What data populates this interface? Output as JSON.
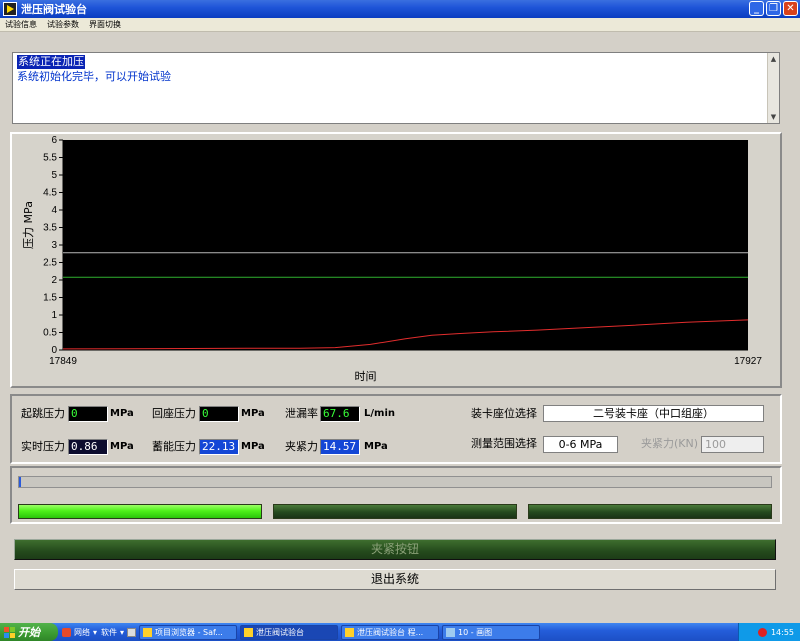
{
  "window": {
    "title": "泄压阀试验台"
  },
  "menu": [
    "试验信息",
    "试验参数",
    "界面切换"
  ],
  "messages": [
    "系统正在加压",
    "系统初始化完毕，可以开始试验"
  ],
  "chart_data": {
    "type": "line",
    "xlabel": "时间",
    "ylabel": "压力 MPa",
    "xlim": [
      17849,
      17927
    ],
    "ylim": [
      0,
      6
    ],
    "yticks": [
      "0",
      "0.5",
      "1",
      "1.5",
      "2",
      "2.5",
      "3",
      "3.5",
      "4",
      "4.5",
      "5",
      "5.5",
      "6"
    ],
    "xticks": [
      "17849",
      "17927"
    ],
    "background": "#000000",
    "series": [
      {
        "color": "#e22d2d",
        "points": [
          [
            17849,
            0.03
          ],
          [
            17860,
            0.04
          ],
          [
            17870,
            0.05
          ],
          [
            17876,
            0.05
          ],
          [
            17880,
            0.07
          ],
          [
            17884,
            0.16
          ],
          [
            17888,
            0.32
          ],
          [
            17891,
            0.42
          ],
          [
            17894,
            0.47
          ],
          [
            17898,
            0.52
          ],
          [
            17903,
            0.57
          ],
          [
            17908,
            0.63
          ],
          [
            17914,
            0.71
          ],
          [
            17920,
            0.79
          ],
          [
            17927,
            0.86
          ]
        ]
      },
      {
        "color": "#b8b8b8",
        "points": [
          [
            17849,
            2.78
          ],
          [
            17927,
            2.78
          ]
        ]
      },
      {
        "color": "#2faf2f",
        "points": [
          [
            17849,
            2.08
          ],
          [
            17927,
            2.08
          ]
        ]
      }
    ]
  },
  "params": {
    "start_pressure": {
      "label": "起跳压力",
      "value": "0",
      "unit": "MPa"
    },
    "return_pressure": {
      "label": "回座压力",
      "value": "0",
      "unit": "MPa"
    },
    "leak_rate": {
      "label": "泄漏率",
      "value": "67.6",
      "unit": "L/min"
    },
    "realtime_pressure": {
      "label": "实时压力",
      "value": "0.86",
      "unit": "MPa"
    },
    "accum_pressure": {
      "label": "蓄能压力",
      "value": "22.13",
      "unit": "MPa"
    },
    "clamp_force": {
      "label": "夹紧力",
      "value": "14.57",
      "unit": "MPa"
    }
  },
  "selects": {
    "seat_label": "装卡座位选择",
    "seat_value": "二号装卡座（中口组座）",
    "range_label": "测量范围选择",
    "range_value": "0-6  MPa",
    "clamp_kn_label": "夹紧力(KN)",
    "clamp_kn_value": "100"
  },
  "progress": {
    "value": 0.003,
    "color": "#2a5adb"
  },
  "indicators": [
    {
      "state": "on",
      "color": "#4ef01a"
    },
    {
      "state": "off",
      "color": "#254a1e"
    },
    {
      "state": "off",
      "color": "#254a1e"
    }
  ],
  "buttons": {
    "clamp": "夹紧按钮",
    "exit": "退出系统"
  },
  "taskbar": {
    "start": "开始",
    "items": [
      "网络",
      "软件"
    ],
    "tasks": [
      "项目浏览器 - Saf...",
      "泄压阀试验台",
      "泄压阀试验台 程...",
      "10 - 画图"
    ],
    "time": "14:55"
  }
}
